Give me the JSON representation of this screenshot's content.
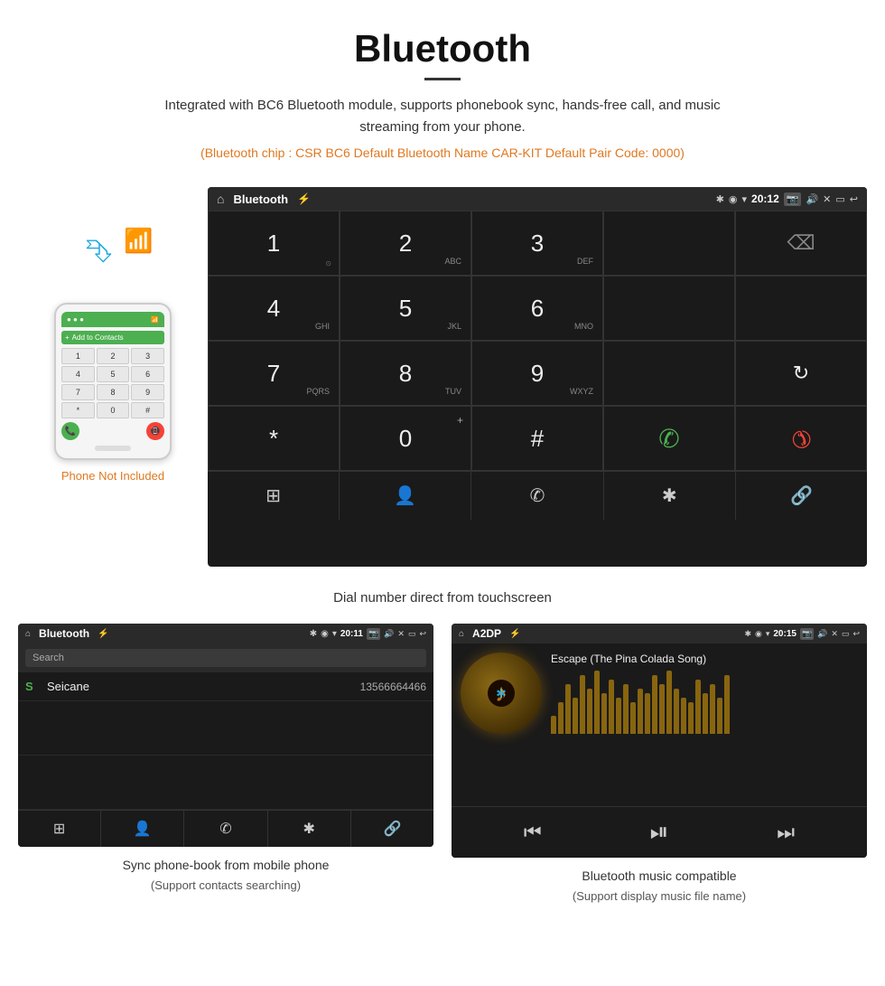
{
  "header": {
    "title": "Bluetooth",
    "description": "Integrated with BC6 Bluetooth module, supports phonebook sync, hands-free call, and music streaming from your phone.",
    "specs": "(Bluetooth chip : CSR BC6    Default Bluetooth Name CAR-KIT    Default Pair Code: 0000)"
  },
  "phone_label": "Phone Not Included",
  "main_screen": {
    "title": "Bluetooth",
    "time": "20:12",
    "keys": [
      {
        "main": "1",
        "sub": ""
      },
      {
        "main": "2",
        "sub": "ABC"
      },
      {
        "main": "3",
        "sub": "DEF"
      },
      {
        "main": "",
        "sub": ""
      },
      {
        "main": "⌫",
        "sub": ""
      },
      {
        "main": "4",
        "sub": "GHI"
      },
      {
        "main": "5",
        "sub": "JKL"
      },
      {
        "main": "6",
        "sub": "MNO"
      },
      {
        "main": "",
        "sub": ""
      },
      {
        "main": "",
        "sub": ""
      },
      {
        "main": "7",
        "sub": "PQRS"
      },
      {
        "main": "8",
        "sub": "TUV"
      },
      {
        "main": "9",
        "sub": "WXYZ"
      },
      {
        "main": "",
        "sub": ""
      },
      {
        "main": "↻",
        "sub": ""
      },
      {
        "main": "*",
        "sub": ""
      },
      {
        "main": "0",
        "sub": "+"
      },
      {
        "main": "#",
        "sub": ""
      },
      {
        "main": "✆",
        "sub": ""
      },
      {
        "main": "✆",
        "sub": ""
      }
    ],
    "toolbar": [
      "⊞",
      "👤",
      "✆",
      "✱",
      "🔗"
    ]
  },
  "dial_caption": "Dial number direct from touchscreen",
  "phonebook_screen": {
    "title": "Bluetooth",
    "time": "20:11",
    "search_placeholder": "Search",
    "contacts": [
      {
        "letter": "S",
        "name": "Seicane",
        "number": "13566664466"
      }
    ]
  },
  "phonebook_caption": "Sync phone-book from mobile phone",
  "phonebook_caption_sub": "(Support contacts searching)",
  "music_screen": {
    "title": "A2DP",
    "time": "20:15",
    "song_title": "Escape (The Pina Colada Song)",
    "eq_bars": [
      20,
      35,
      55,
      40,
      65,
      50,
      70,
      45,
      60,
      40,
      55,
      35,
      50,
      45,
      65,
      55,
      70,
      50,
      40,
      35,
      60,
      45,
      55,
      40,
      65
    ]
  },
  "music_caption": "Bluetooth music compatible",
  "music_caption_sub": "(Support display music file name)"
}
